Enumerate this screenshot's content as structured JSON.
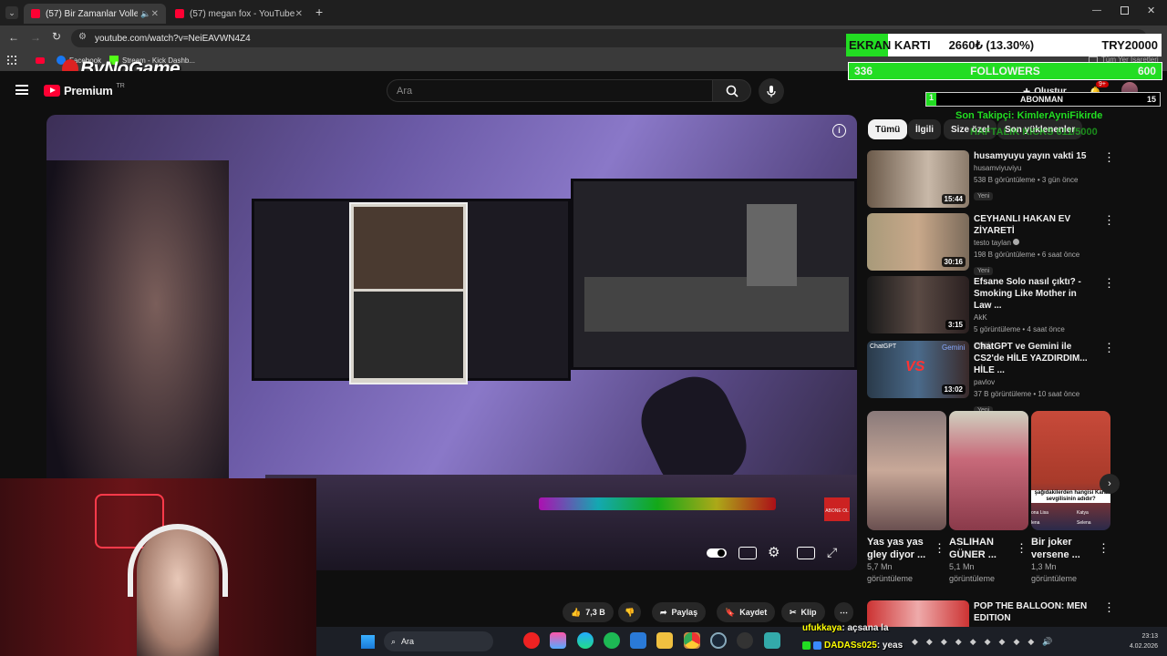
{
  "tabs": [
    {
      "title": "(57) Bir Zamanlar Voller / M",
      "audio_icon": "speaker-icon"
    },
    {
      "title": "(57) megan fox - YouTube"
    }
  ],
  "url": "youtube.com/watch?v=NeiEAVWN4Z4",
  "bookmarks": [
    "Facebook",
    "Stream - Kick Dashb...",
    "Tüm Yer İşaretleri"
  ],
  "watermark": "ByNoGame",
  "youtube": {
    "logo_text": "Premium",
    "region": "TR",
    "search_placeholder": "Ara",
    "create_label": "Oluştur",
    "notif_badge": "9+"
  },
  "chips": [
    "Tümü",
    "İlgili",
    "Size özel",
    "Son yüklenenler"
  ],
  "recommendations": [
    {
      "title": "husamyuyu yayın vakti 15",
      "channel": "husamviyuviyu",
      "views": "538 B görüntüleme",
      "age": "3 gün önce",
      "duration": "15:44",
      "badge": "Yeni"
    },
    {
      "title": "CEYHANLI HAKAN EV ZİYARETİ",
      "channel": "testo taylan",
      "views": "198 B görüntüleme",
      "age": "6 saat önce",
      "duration": "30:16",
      "badge": "Yeni"
    },
    {
      "title": "Efsane Solo nasıl çıktı? - Smoking Like Mother in Law ...",
      "channel": "AkK",
      "views": "5 görüntüleme",
      "age": "4 saat önce",
      "duration": "3:15",
      "badge": "Yeni"
    },
    {
      "title": "ChatGPT ve Gemini ile CS2'de HİLE YAZDIRDIM... HİLE ...",
      "channel": "pavlov",
      "views": "37 B görüntüleme",
      "age": "10 saat önce",
      "duration": "13:02",
      "badge": "Yeni"
    }
  ],
  "rec_thumb_text": [
    "ChatGPT",
    "VS",
    "Gemini"
  ],
  "shorts": [
    {
      "title": "Yas yas yas gley diyor ...",
      "views": "5,7 Mn görüntüleme"
    },
    {
      "title": "ASLIHAN GÜNER ...",
      "views": "5,1 Mn görüntüleme"
    },
    {
      "title": "Bir joker versene ...",
      "views": "1,3 Mn görüntüleme"
    }
  ],
  "short_thumb_text": {
    "question": "şağıdakilerden hangisi Kara sevgilisinin adıdır?",
    "opt1": "ona Lisa",
    "opt2": "lena",
    "opt3": "Katya",
    "opt4": "Selena"
  },
  "next_rec": {
    "title": "POP THE BALLOON: MEN EDITION"
  },
  "actions": {
    "likes": "7,3 B",
    "share": "Paylaş",
    "save": "Kaydet",
    "clip": "Klip"
  },
  "overlay": {
    "gpu_label": "EKRAN KARTI",
    "gpu_price": "2660₺ (13.30%)",
    "goal": "TRY20000",
    "followers_current": "336",
    "followers_label": "FOLLOWERS",
    "followers_goal": "600",
    "sub_current": "1",
    "sub_label": "ABONMAN",
    "sub_goal": "15",
    "last_follower": "Son Takipçi: KimlerAyniFikirde",
    "weekly": "HAFTALIK KICKS 611/5000",
    "video_corner": "ABONE OL"
  },
  "chat": [
    {
      "user": "ufukkaya",
      "msg": ": açsana la"
    },
    {
      "user": "DADASs025",
      "msg": ": yeas"
    }
  ],
  "taskbar": {
    "search": "Ara",
    "time": "23:13",
    "date": "4.02.2026"
  },
  "colors": {
    "accent": "#ff0033",
    "follower_bar": "#22dd22",
    "chat_user": "#ffff00"
  }
}
